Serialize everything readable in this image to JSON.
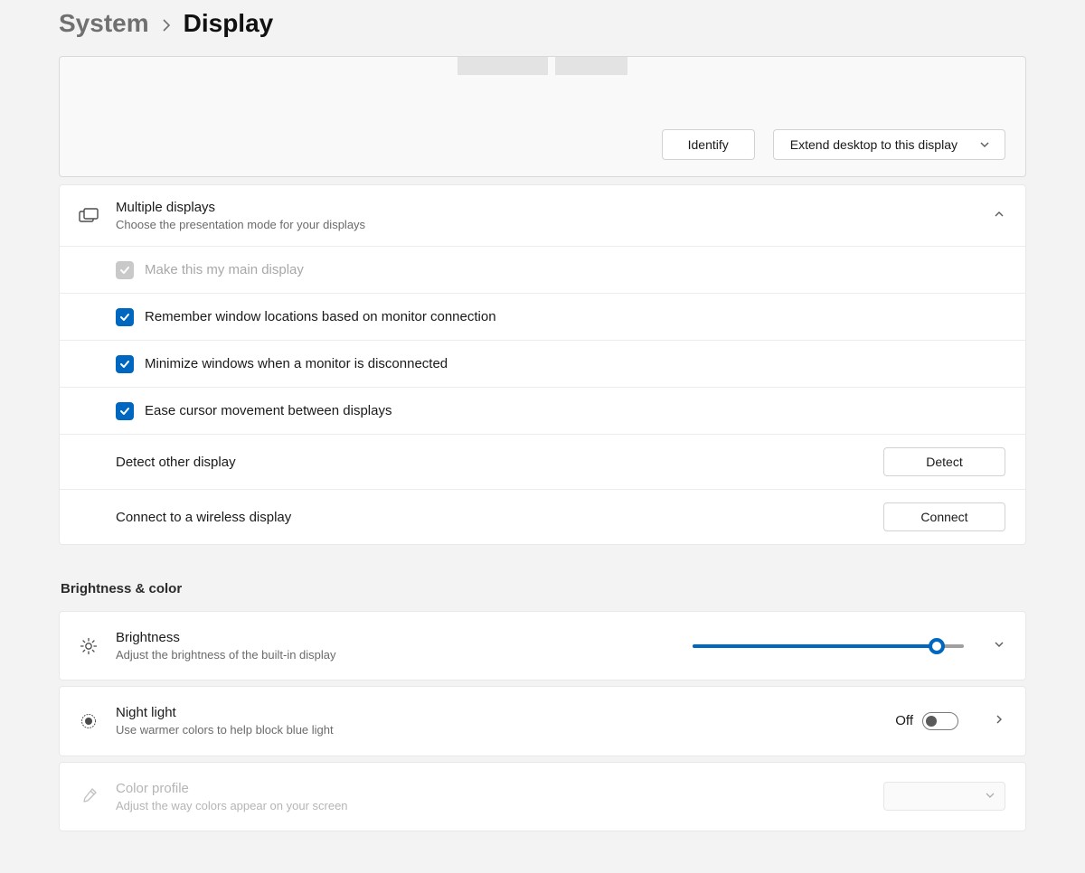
{
  "breadcrumb": {
    "parent": "System",
    "current": "Display"
  },
  "arrange": {
    "identify_label": "Identify",
    "mode_dropdown_label": "Extend desktop to this display"
  },
  "multiple_displays": {
    "title": "Multiple displays",
    "subtitle": "Choose the presentation mode for your displays",
    "options": [
      {
        "label": "Make this my main display",
        "checked": true,
        "disabled": true
      },
      {
        "label": "Remember window locations based on monitor connection",
        "checked": true,
        "disabled": false
      },
      {
        "label": "Minimize windows when a monitor is disconnected",
        "checked": true,
        "disabled": false
      },
      {
        "label": "Ease cursor movement between displays",
        "checked": true,
        "disabled": false
      }
    ],
    "detect_label": "Detect other display",
    "detect_button": "Detect",
    "connect_label": "Connect to a wireless display",
    "connect_button": "Connect"
  },
  "brightness_color_heading": "Brightness & color",
  "brightness": {
    "title": "Brightness",
    "subtitle": "Adjust the brightness of the built-in display",
    "value_pct": 90
  },
  "night_light": {
    "title": "Night light",
    "subtitle": "Use warmer colors to help block blue light",
    "state_label": "Off",
    "on": false
  },
  "color_profile": {
    "title": "Color profile",
    "subtitle": "Adjust the way colors appear on your screen"
  }
}
